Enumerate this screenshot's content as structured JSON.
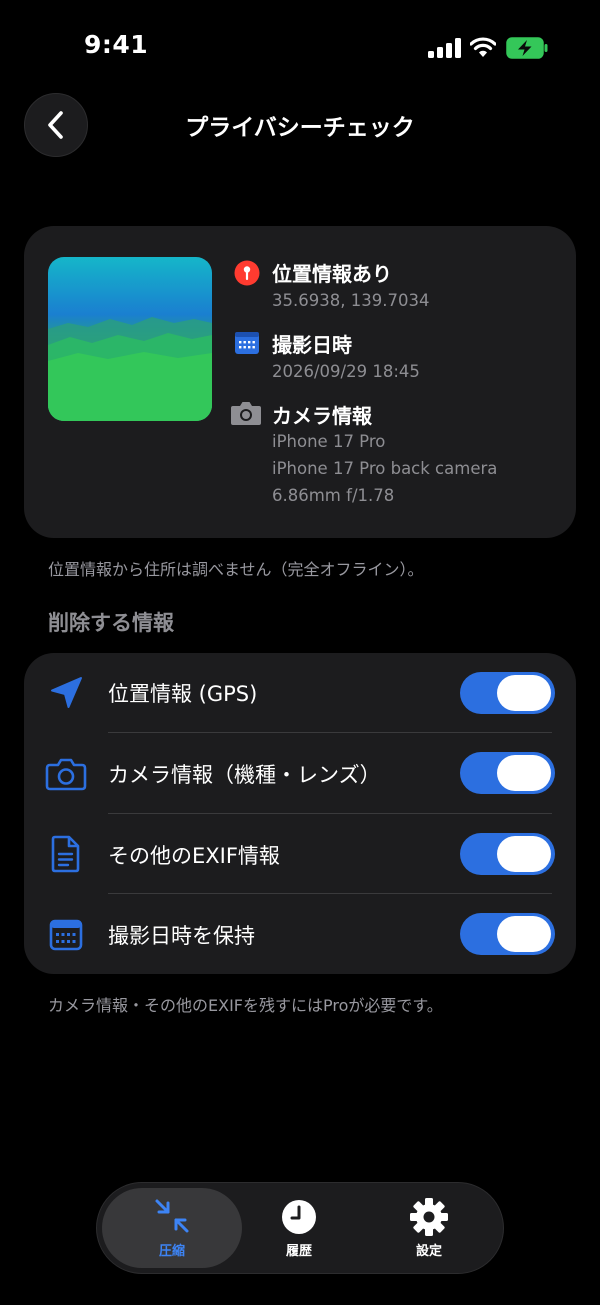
{
  "status": {
    "time": "9:41"
  },
  "header": {
    "title": "プライバシーチェック"
  },
  "metadata": {
    "location": {
      "title": "位置情報あり",
      "value": "35.6938, 139.7034"
    },
    "date": {
      "title": "撮影日時",
      "value": "2026/09/29 18:45"
    },
    "camera": {
      "title": "カメラ情報",
      "model": "iPhone 17 Pro",
      "lens": "iPhone 17 Pro back camera",
      "spec": "6.86mm f/1.78"
    }
  },
  "offline_note": "位置情報から住所は調べません（完全オフライン）。",
  "remove_section": {
    "heading": "削除する情報",
    "items": [
      {
        "label": "位置情報 (GPS)",
        "icon": "location-arrow-icon",
        "on": true
      },
      {
        "label": "カメラ情報（機種・レンズ）",
        "icon": "camera-icon",
        "on": true
      },
      {
        "label": "その他のEXIF情報",
        "icon": "document-icon",
        "on": true
      },
      {
        "label": "撮影日時を保持",
        "icon": "calendar-icon",
        "on": true
      }
    ]
  },
  "pro_note": "カメラ情報・その他のEXIFを残すにはProが必要です。",
  "tabbar": {
    "tabs": [
      {
        "label": "圧縮",
        "icon": "compress-icon",
        "selected": true
      },
      {
        "label": "履歴",
        "icon": "clock-icon",
        "selected": false
      },
      {
        "label": "設定",
        "icon": "gear-icon",
        "selected": false
      }
    ]
  },
  "colors": {
    "accent": "#2c6fe0",
    "background": "#000000",
    "card": "#1c1c1e",
    "pin": "#ff3b30",
    "battery": "#34c759"
  }
}
